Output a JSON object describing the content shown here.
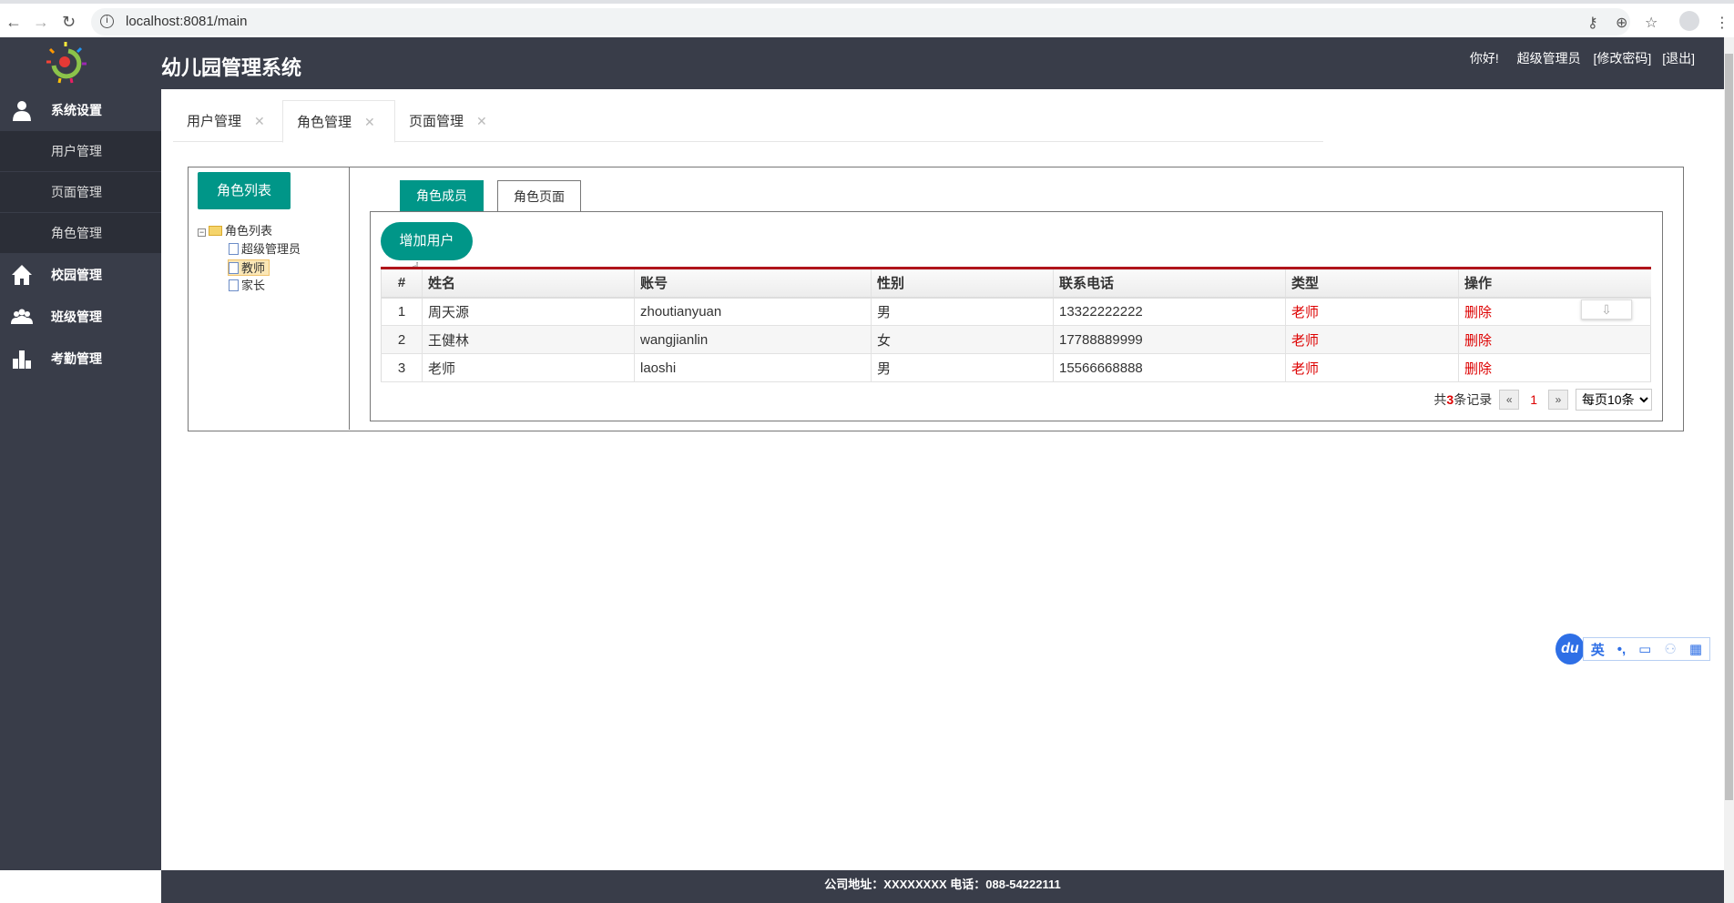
{
  "browser": {
    "url": "localhost:8081/main"
  },
  "header": {
    "title": "幼儿园管理系统",
    "greeting": "你好!",
    "username": "超级管理员",
    "change_password": "[修改密码]",
    "logout": "[退出]"
  },
  "sidebar": {
    "groups": [
      {
        "label": "系统设置",
        "icon": "user-icon",
        "items": [
          "用户管理",
          "页面管理",
          "角色管理"
        ]
      },
      {
        "label": "校园管理",
        "icon": "home-icon"
      },
      {
        "label": "班级管理",
        "icon": "group-icon"
      },
      {
        "label": "考勤管理",
        "icon": "bar-chart-icon"
      }
    ]
  },
  "tabs": [
    {
      "label": "用户管理",
      "close": "✕"
    },
    {
      "label": "角色管理",
      "close": "✕",
      "active": true
    },
    {
      "label": "页面管理",
      "close": "✕"
    }
  ],
  "role_panel": {
    "button": "角色列表",
    "tree": {
      "root": "角色列表",
      "children": [
        "超级管理员",
        "教师",
        "家长"
      ],
      "selected": "教师"
    }
  },
  "inner_tabs": [
    "角色成员",
    "角色页面"
  ],
  "add_button": "增加用户",
  "table": {
    "headers": [
      "#",
      "姓名",
      "账号",
      "性别",
      "联系电话",
      "类型",
      "操作"
    ],
    "rows": [
      [
        "1",
        "周天源",
        "zhoutianyuan",
        "男",
        "13322222222",
        "老师",
        "删除"
      ],
      [
        "2",
        "王健林",
        "wangjianlin",
        "女",
        "17788889999",
        "老师",
        "删除"
      ],
      [
        "3",
        "老师",
        "laoshi",
        "男",
        "15566668888",
        "老师",
        "删除"
      ]
    ]
  },
  "pager": {
    "prefix": "共",
    "count": "3",
    "suffix": "条记录",
    "prev": "«",
    "page": "1",
    "next": "»",
    "page_size": "每页10条"
  },
  "footer": {
    "line1": "公司地址：XXXXXXXX 电话：088-54222111"
  },
  "ime": {
    "logo": "du",
    "lang": "英",
    "punct": "•,"
  },
  "colors": {
    "accent": "#009688",
    "header": "#393d49",
    "danger": "#dd0000"
  }
}
